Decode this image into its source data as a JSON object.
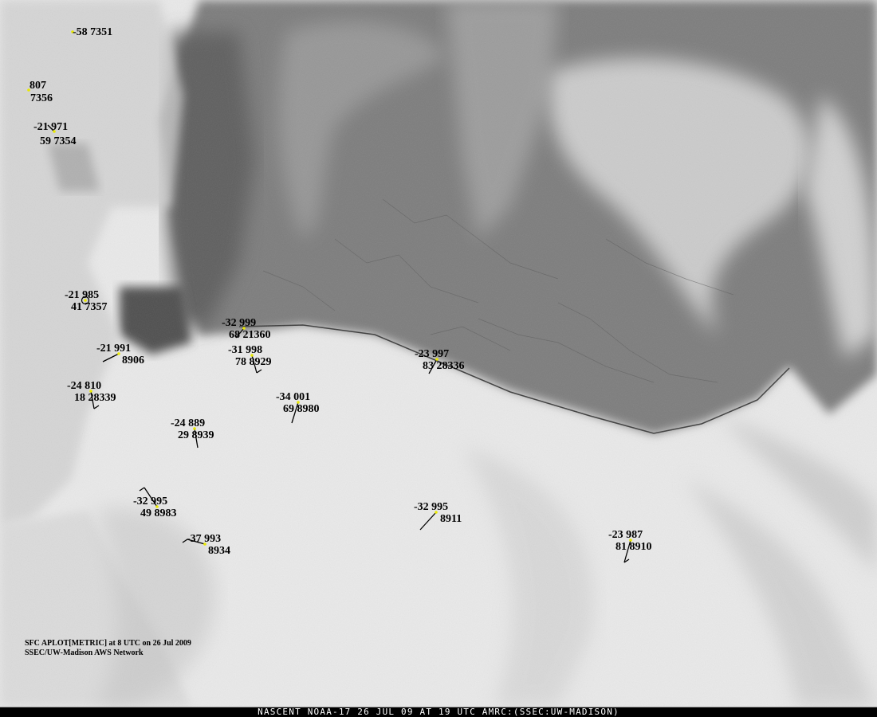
{
  "caption": {
    "line1": "SFC APLOT[METRIC] at 8 UTC on 26 Jul 2009",
    "line2": "SSEC/UW-Madison AWS Network"
  },
  "footer": "NASCENT NOAA-17 26 JUL 09 AT 19 UTC AMRC:(SSEC:UW-MADISON)",
  "stations": [
    {
      "temp": "-58",
      "pressure": "",
      "id": "7351",
      "second_line": "",
      "barb": "none"
    },
    {
      "temp": "",
      "pressure": "807",
      "id": "",
      "second_line": "7356",
      "barb": "none"
    },
    {
      "temp": "-21",
      "pressure": "971",
      "id": "7354",
      "second_line": "59",
      "barb": "light"
    },
    {
      "temp": "-21",
      "pressure": "985",
      "id": "7357",
      "second_line": "41",
      "barb": "calm"
    },
    {
      "temp": "-32",
      "pressure": "999",
      "id": "21360",
      "second_line": "68",
      "barb": "light"
    },
    {
      "temp": "-21",
      "pressure": "991",
      "id": "8906",
      "second_line": "",
      "barb": "light"
    },
    {
      "temp": "-31",
      "pressure": "998",
      "id": "8929",
      "second_line": "78",
      "barb": "barbed"
    },
    {
      "temp": "-23",
      "pressure": "997",
      "id": "28336",
      "second_line": "83",
      "barb": "light"
    },
    {
      "temp": "-24",
      "pressure": "810",
      "id": "28339",
      "second_line": "18",
      "barb": "barbed"
    },
    {
      "temp": "-34",
      "pressure": "001",
      "id": "8980",
      "second_line": "69",
      "barb": "light"
    },
    {
      "temp": "-24",
      "pressure": "889",
      "id": "8939",
      "second_line": "29",
      "barb": "light"
    },
    {
      "temp": "-32",
      "pressure": "995",
      "id": "8983",
      "second_line": "49",
      "barb": "barbed"
    },
    {
      "temp": "-32",
      "pressure": "995",
      "id": "8911",
      "second_line": "",
      "barb": "light"
    },
    {
      "temp": "-37",
      "pressure": "993",
      "id": "8934",
      "second_line": "",
      "barb": "barbed"
    },
    {
      "temp": "-23",
      "pressure": "987",
      "id": "8910",
      "second_line": "81",
      "barb": "barbed"
    }
  ],
  "colors": {
    "station_dot": "#e8e800",
    "text": "#000000",
    "ice_shelf": "#f1f1f1",
    "open_ocean": "#8a8a8a"
  }
}
